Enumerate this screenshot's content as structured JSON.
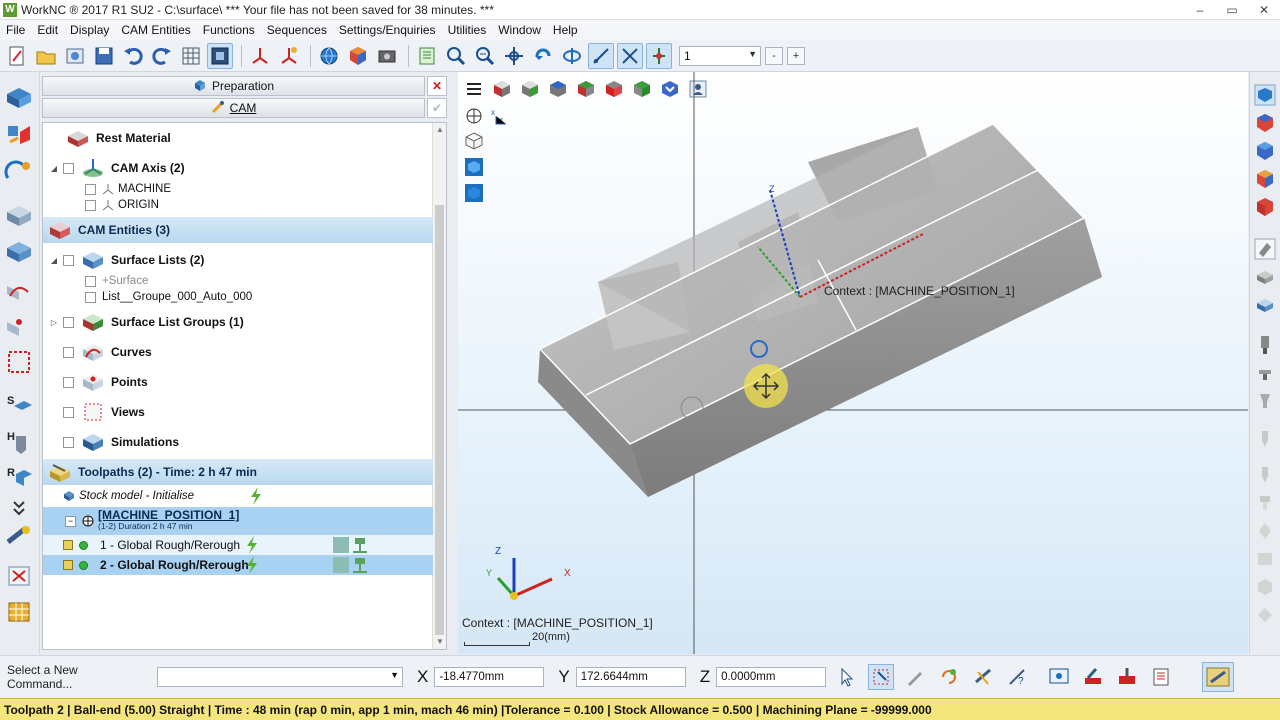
{
  "window": {
    "title": "WorkNC ® 2017 R1 SU2 - C:\\surface\\ *** Your file has not been saved for 38 minutes. ***",
    "logo": "W",
    "controls": [
      "–",
      "▭",
      "✕"
    ]
  },
  "menu": [
    "File",
    "Edit",
    "Display",
    "CAM Entities",
    "Functions",
    "Sequences",
    "Settings/Enquiries",
    "Utilities",
    "Window",
    "Help"
  ],
  "toolbar": {
    "layer_value": "1",
    "minus_label": "-",
    "plus_label": "+"
  },
  "panel": {
    "preparation_label": "Preparation",
    "cam_label": "CAM",
    "close_icon": "✕",
    "check_icon": "✔"
  },
  "tree": {
    "rest_material": "Rest Material",
    "cam_axis": "CAM Axis (2)",
    "cam_axis_children": [
      "MACHINE",
      "ORIGIN"
    ],
    "cam_entities": "CAM Entities (3)",
    "surface_lists": "Surface Lists (2)",
    "surface_lists_children": [
      "+Surface",
      "List__Groupe_000_Auto_000"
    ],
    "surface_list_groups": "Surface List Groups (1)",
    "curves": "Curves",
    "points": "Points",
    "views": "Views",
    "simulations": "Simulations",
    "toolpaths": "Toolpaths (2) - Time: 2 h 47 min",
    "stock_model": "Stock model - Initialise",
    "machine_position": "[MACHINE_POSITION_1]",
    "machine_position_sub": "(1-2) Duration 2 h 47 min",
    "toolpath_1": "1 - Global Rough/Rerough",
    "toolpath_2": "2 - Global Rough/Rerough"
  },
  "viewport": {
    "context_top": "Context : [MACHINE_POSITION_1]",
    "context_bottom": "Context : [MACHINE_POSITION_1]",
    "scale_label": "20(mm)",
    "triad_labels": {
      "z": "Z",
      "y": "Y",
      "x": "X",
      "axis_z": "Z"
    },
    "colors": {
      "part": "#a9a9a9",
      "part_light": "#d2d2d2",
      "accent": "#1976d2"
    }
  },
  "command": {
    "prompt": "Select a New Command...",
    "x_label": "X",
    "x_value": "-18.4770mm",
    "y_label": "Y",
    "y_value": "172.6644mm",
    "z_label": "Z",
    "z_value": "0.0000mm"
  },
  "status": {
    "text": "Toolpath 2 | Ball-end (5.00) Straight | Time : 48 min (rap 0 min, app 1 min, mach 46 min) |Tolerance = 0.100 | Stock Allowance = 0.500 | Machining Plane = -99999.000",
    "background": "#f5e57d"
  }
}
